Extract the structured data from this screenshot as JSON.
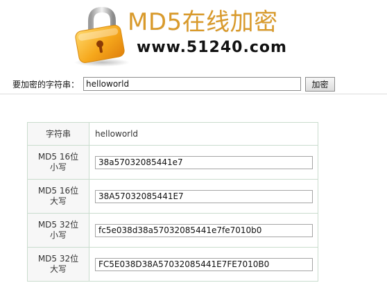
{
  "header": {
    "title": "MD5在线加密",
    "site": "www.51240.com",
    "logo_icon": "padlock-icon"
  },
  "form": {
    "label": "要加密的字符串：",
    "value": "helloworld",
    "button_label": "加密"
  },
  "results": {
    "rows": [
      {
        "label_line1": "字符串",
        "label_line2": "",
        "value": "helloworld"
      },
      {
        "label_line1": "MD5 16位",
        "label_line2": "小写",
        "value": "38a57032085441e7"
      },
      {
        "label_line1": "MD5 16位",
        "label_line2": "大写",
        "value": "38A57032085441E7"
      },
      {
        "label_line1": "MD5 32位",
        "label_line2": "小写",
        "value": "fc5e038d38a57032085441e7fe7010b0"
      },
      {
        "label_line1": "MD5 32位",
        "label_line2": "大写",
        "value": "FC5E038D38A57032085441E7FE7010B0"
      }
    ]
  },
  "colors": {
    "title": "#d99a2b",
    "table_border": "#c9dccd",
    "label_bg": "#f7f7f7"
  }
}
